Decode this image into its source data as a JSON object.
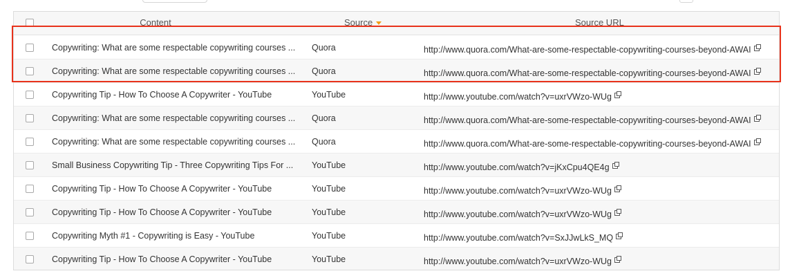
{
  "table": {
    "headers": {
      "content": "Content",
      "source": "Source",
      "source_url": "Source URL"
    },
    "sort": {
      "column": "source",
      "direction": "desc",
      "indicator_color": "#f39c12"
    },
    "rows": [
      {
        "content": "Copywriting: What are some respectable copywriting courses ...",
        "source": "Quora",
        "url": "http://www.quora.com/What-are-some-respectable-copywriting-courses-beyond-AWAI"
      },
      {
        "content": "Copywriting: What are some respectable copywriting courses ...",
        "source": "Quora",
        "url": "http://www.quora.com/What-are-some-respectable-copywriting-courses-beyond-AWAI"
      },
      {
        "content": "Copywriting Tip - How To Choose A Copywriter - YouTube",
        "source": "YouTube",
        "url": "http://www.youtube.com/watch?v=uxrVWzo-WUg"
      },
      {
        "content": "Copywriting: What are some respectable copywriting courses ...",
        "source": "Quora",
        "url": "http://www.quora.com/What-are-some-respectable-copywriting-courses-beyond-AWAI"
      },
      {
        "content": "Copywriting: What are some respectable copywriting courses ...",
        "source": "Quora",
        "url": "http://www.quora.com/What-are-some-respectable-copywriting-courses-beyond-AWAI"
      },
      {
        "content": "Small Business Copywriting Tip - Three Copywriting Tips For ...",
        "source": "YouTube",
        "url": "http://www.youtube.com/watch?v=jKxCpu4QE4g"
      },
      {
        "content": "Copywriting Tip - How To Choose A Copywriter - YouTube",
        "source": "YouTube",
        "url": "http://www.youtube.com/watch?v=uxrVWzo-WUg"
      },
      {
        "content": "Copywriting Tip - How To Choose A Copywriter - YouTube",
        "source": "YouTube",
        "url": "http://www.youtube.com/watch?v=uxrVWzo-WUg"
      },
      {
        "content": "Copywriting Myth #1 - Copywriting is Easy - YouTube",
        "source": "YouTube",
        "url": "http://www.youtube.com/watch?v=SxJJwLkS_MQ"
      },
      {
        "content": "Copywriting Tip - How To Choose A Copywriter - YouTube",
        "source": "YouTube",
        "url": "http://www.youtube.com/watch?v=uxrVWzo-WUg"
      }
    ]
  },
  "highlight": {
    "rows": [
      0,
      1
    ],
    "color": "#e8321b"
  }
}
